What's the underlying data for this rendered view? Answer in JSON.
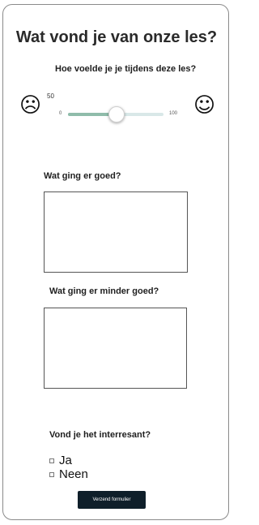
{
  "form": {
    "title": "Wat vond je van onze les?",
    "feeling": {
      "question": "Hoe voelde je je tijdens deze les?",
      "sad_face": "☹",
      "happy_face": "☺",
      "value": "50",
      "min": "0",
      "max": "100",
      "value_fraction": 0.5,
      "fill_color": "#8fbcaa",
      "track_color": "#d9e8e8"
    },
    "good": {
      "question": "Wat ging er goed?",
      "value": ""
    },
    "less_good": {
      "question": "Wat ging er minder goed?",
      "value": ""
    },
    "interesting": {
      "question": "Vond je het interresant?",
      "options": [
        {
          "label": "Ja",
          "checked": false
        },
        {
          "label": "Neen",
          "checked": false
        }
      ]
    },
    "submit_label": "Verzend formulier",
    "submit_color": "#0f1f2a"
  }
}
